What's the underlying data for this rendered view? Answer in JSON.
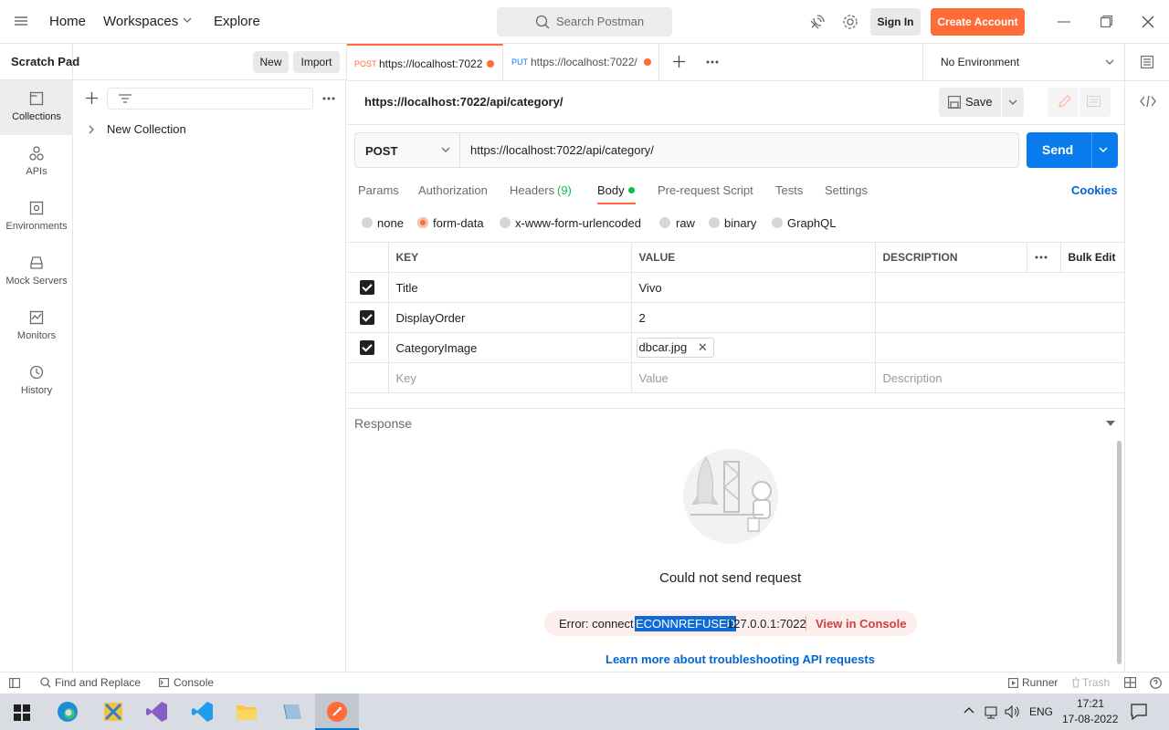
{
  "nav": {
    "home": "Home",
    "workspaces": "Workspaces",
    "explore": "Explore",
    "search_placeholder": "Search Postman",
    "sign_in": "Sign In",
    "create_account": "Create Account"
  },
  "sidebar": {
    "title": "Scratch Pad",
    "new_label": "New",
    "import_label": "Import",
    "collection_name": "New Collection",
    "rail": [
      {
        "label": "Collections"
      },
      {
        "label": "APIs"
      },
      {
        "label": "Environments"
      },
      {
        "label": "Mock Servers"
      },
      {
        "label": "Monitors"
      },
      {
        "label": "History"
      }
    ]
  },
  "tabs": [
    {
      "method": "POST",
      "url": "https://localhost:7022",
      "method_color": "#ff6c37"
    },
    {
      "method": "PUT",
      "url": "https://localhost:7022/",
      "method_color": "#097bed"
    }
  ],
  "environment": "No Environment",
  "request": {
    "title": "https://localhost:7022/api/category/",
    "save_label": "Save",
    "method": "POST",
    "url": "https://localhost:7022/api/category/",
    "send_label": "Send"
  },
  "subtabs": {
    "params": "Params",
    "authorization": "Authorization",
    "headers": "Headers",
    "headers_count": "(9)",
    "body": "Body",
    "prerequest": "Pre-request Script",
    "tests": "Tests",
    "settings": "Settings",
    "cookies": "Cookies"
  },
  "body_modes": {
    "none": "none",
    "form_data": "form-data",
    "urlencoded": "x-www-form-urlencoded",
    "raw": "raw",
    "binary": "binary",
    "graphql": "GraphQL"
  },
  "table": {
    "headers": {
      "key": "KEY",
      "value": "VALUE",
      "description": "DESCRIPTION",
      "bulk_edit": "Bulk Edit"
    },
    "rows": [
      {
        "key": "Title",
        "value": "Vivo"
      },
      {
        "key": "DisplayOrder",
        "value": "2"
      },
      {
        "key": "CategoryImage",
        "value": "dbcar.jpg"
      }
    ],
    "placeholders": {
      "key": "Key",
      "value": "Value",
      "description": "Description"
    }
  },
  "response": {
    "label": "Response",
    "message": "Could not send request",
    "error_prefix": "Error: connect",
    "error_code": "ECONNREFUSED",
    "error_addr": "127.0.0.1:7022",
    "view_console": "View in Console",
    "learn_more": "Learn more about troubleshooting API requests"
  },
  "statusbar": {
    "find_replace": "Find and Replace",
    "console": "Console",
    "runner": "Runner",
    "trash": "Trash"
  },
  "taskbar": {
    "lang": "ENG",
    "time": "17:21",
    "date": "17-08-2022"
  },
  "colors": {
    "accent": "#ff6c37",
    "primary": "#097bed",
    "success": "#0cbb52",
    "link": "#0265d2"
  }
}
